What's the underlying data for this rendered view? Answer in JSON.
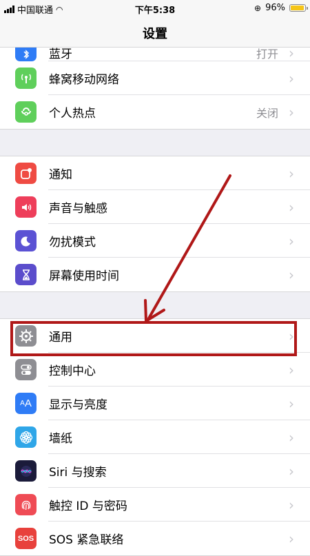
{
  "status_bar": {
    "carrier": "中国联通",
    "time": "下午5:38",
    "battery_pct": "96%"
  },
  "nav": {
    "title": "设置"
  },
  "groups": [
    {
      "items": [
        {
          "label": "蓝牙",
          "value": "打开",
          "icon": "bluetooth-icon",
          "color": "#2f7cf6"
        },
        {
          "label": "蜂窝移动网络",
          "value": "",
          "icon": "cellular-icon",
          "color": "#5fcf5b"
        },
        {
          "label": "个人热点",
          "value": "关闭",
          "icon": "hotspot-icon",
          "color": "#5fcf5b"
        }
      ]
    },
    {
      "items": [
        {
          "label": "通知",
          "icon": "notifications-icon",
          "color": "#ef4b43"
        },
        {
          "label": "声音与触感",
          "icon": "sound-icon",
          "color": "#ee3e5a"
        },
        {
          "label": "勿扰模式",
          "icon": "moon-icon",
          "color": "#5b52d4"
        },
        {
          "label": "屏幕使用时间",
          "icon": "hourglass-icon",
          "color": "#5b4dcc"
        }
      ]
    },
    {
      "items": [
        {
          "label": "通用",
          "icon": "gear-icon",
          "color": "#8e8e93",
          "highlighted": true
        },
        {
          "label": "控制中心",
          "icon": "toggles-icon",
          "color": "#8e8e93"
        },
        {
          "label": "显示与亮度",
          "icon": "display-aa-icon",
          "color": "#2f7cf6"
        },
        {
          "label": "墙纸",
          "icon": "wallpaper-flower-icon",
          "color": "#2fa6e8"
        },
        {
          "label": "Siri 与搜索",
          "icon": "siri-icon",
          "color": "#1b1b3a"
        },
        {
          "label": "触控 ID 与密码",
          "icon": "fingerprint-icon",
          "color": "#ef4b55"
        },
        {
          "label": "SOS 紧急联络",
          "icon": "sos-icon",
          "color": "#e8413c"
        }
      ]
    }
  ],
  "annotation": {
    "color": "#b01818"
  }
}
